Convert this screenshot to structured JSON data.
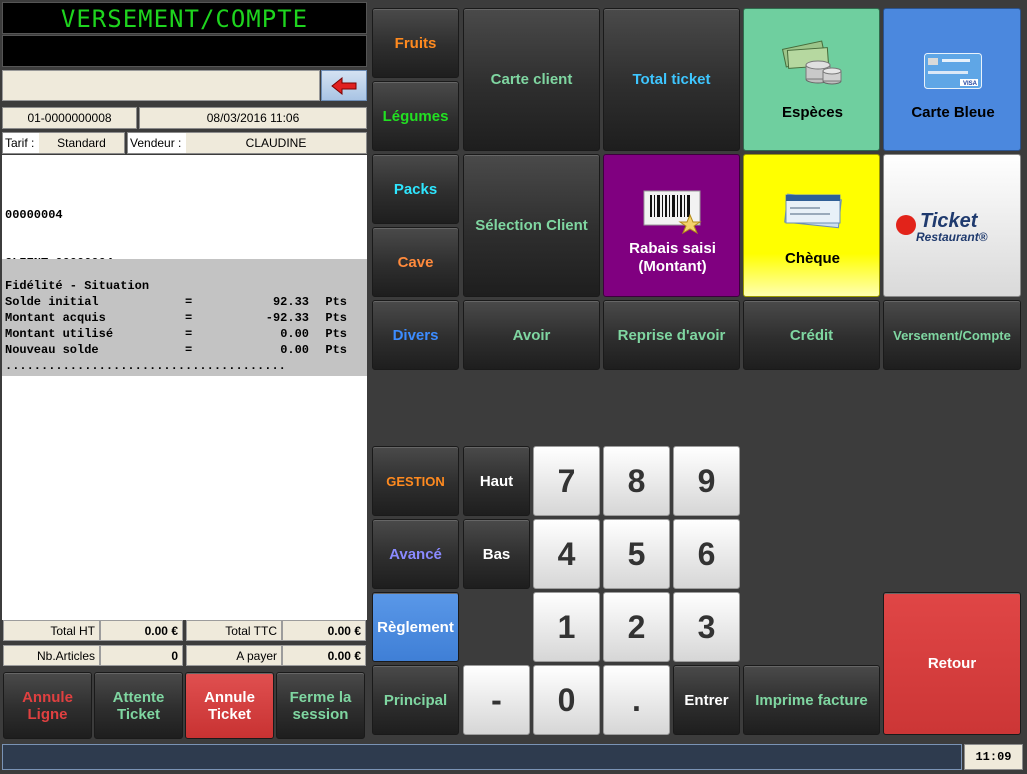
{
  "display": {
    "title": "VERSEMENT/COMPTE"
  },
  "ticket": {
    "number": "01-0000000008",
    "datetime": "08/03/2016 11:06",
    "tarif_label": "Tarif :",
    "tarif_value": "Standard",
    "vendeur_label": "Vendeur :",
    "vendeur_value": "CLAUDINE"
  },
  "receipt": {
    "line1": "00000004",
    "line2": "CLIENT 00000004",
    "section_title": "Fidélité - Situation",
    "rows": [
      {
        "label": "Solde initial",
        "eq": "=",
        "value": "92.33",
        "unit": "Pts"
      },
      {
        "label": "Montant acquis",
        "eq": "=",
        "value": "-92.33",
        "unit": "Pts"
      },
      {
        "label": "Montant utilisé",
        "eq": "=",
        "value": "0.00",
        "unit": "Pts"
      },
      {
        "label": "Nouveau solde",
        "eq": "=",
        "value": "0.00",
        "unit": "Pts"
      }
    ],
    "dots": "......................................."
  },
  "totals": {
    "total_ht_label": "Total HT",
    "total_ht_value": "0.00 €",
    "total_ttc_label": "Total TTC",
    "total_ttc_value": "0.00 €",
    "nb_articles_label": "Nb.Articles",
    "nb_articles_value": "0",
    "a_payer_label": "A payer",
    "a_payer_value": "0.00 €"
  },
  "bottom_buttons": {
    "annule_ligne": "Annule\nLigne",
    "attente_ticket": "Attente\nTicket",
    "annule_ticket": "Annule\nTicket",
    "ferme_session": "Ferme la\nsession"
  },
  "categories": {
    "fruits": "Fruits",
    "legumes": "Légumes",
    "packs": "Packs",
    "cave": "Cave",
    "divers": "Divers"
  },
  "actions": {
    "carte_client": "Carte client",
    "total_ticket": "Total ticket",
    "selection_client": "Sélection Client",
    "avoir": "Avoir",
    "reprise_avoir": "Reprise d'avoir",
    "credit": "Crédit",
    "versement_compte": "Versement/Compte"
  },
  "payments": {
    "especes": "Espèces",
    "carte_bleue": "Carte Bleue",
    "rabais": "Rabais saisi\n(Montant)",
    "cheque": "Chèque",
    "ticket_restaurant_logo": "Ticket Restaurant®"
  },
  "nav": {
    "gestion": "GESTION",
    "avance": "Avancé",
    "reglement": "Règlement",
    "principal": "Principal",
    "haut": "Haut",
    "bas": "Bas"
  },
  "keypad": {
    "k7": "7",
    "k8": "8",
    "k9": "9",
    "k4": "4",
    "k5": "5",
    "k6": "6",
    "k1": "1",
    "k2": "2",
    "k3": "3",
    "minus": "-",
    "k0": "0",
    "dot": ".",
    "entrer": "Entrer",
    "imprime_facture": "Imprime facture",
    "retour": "Retour"
  },
  "status": {
    "clock": "11:09"
  },
  "colors": {
    "fruits": "#ff8a1f",
    "legumes": "#22e022",
    "packs": "#2ee6ff",
    "cave": "#ff8a3c",
    "divers": "#3c8cff",
    "green_text": "#7fd6a1",
    "blue_text": "#3ec6ff",
    "especes_bg": "#6fcf9f",
    "carte_bleue_bg": "#4b88de",
    "rabais_bg": "#800080",
    "cheque_bg": "#ffff00",
    "reglement_bg": "#4b88de",
    "retour_bg": "#d63c3c",
    "annule_red": "#d63c3c"
  }
}
